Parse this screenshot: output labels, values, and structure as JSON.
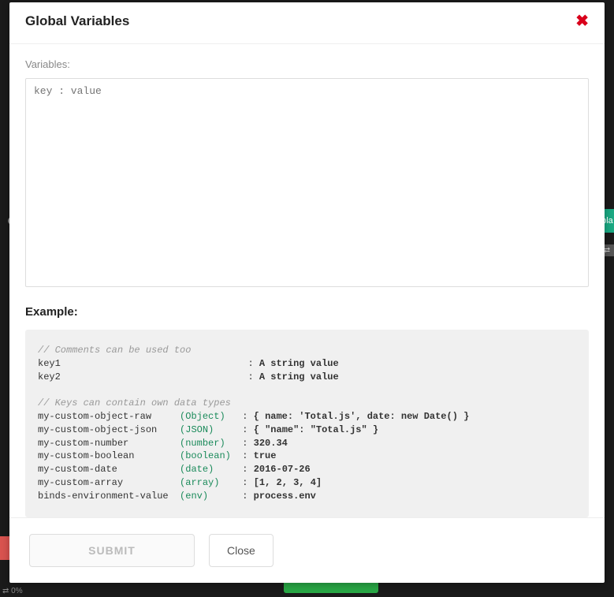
{
  "modal": {
    "title": "Global Variables",
    "form": {
      "label": "Variables:",
      "placeholder": "key : value"
    },
    "example": {
      "heading": "Example:",
      "comment1": "// Comments can be used too",
      "key1_name": "key1",
      "key1_value": "A string value",
      "key2_name": "key2",
      "key2_value": "A string value",
      "comment2": "// Keys can contain own data types",
      "rows": [
        {
          "key": "my-custom-object-raw",
          "type": "(Object)",
          "value": "{ name: 'Total.js', date: new Date() }"
        },
        {
          "key": "my-custom-object-json",
          "type": "(JSON)",
          "value": "{ \"name\": \"Total.js\" }"
        },
        {
          "key": "my-custom-number",
          "type": "(number)",
          "value": "320.34"
        },
        {
          "key": "my-custom-boolean",
          "type": "(boolean)",
          "value": "true"
        },
        {
          "key": "my-custom-date",
          "type": "(date)",
          "value": "2016-07-26"
        },
        {
          "key": "my-custom-array",
          "type": "(array)",
          "value": "[1, 2, 3, 4]"
        },
        {
          "key": "binds-environment-value",
          "type": "(env)",
          "value": "process.env"
        }
      ]
    },
    "buttons": {
      "submit": "SUBMIT",
      "close": "Close"
    }
  },
  "background": {
    "status": "⇄ 0%",
    "badge_green": "npla",
    "badge_gray": "% ⇄"
  }
}
